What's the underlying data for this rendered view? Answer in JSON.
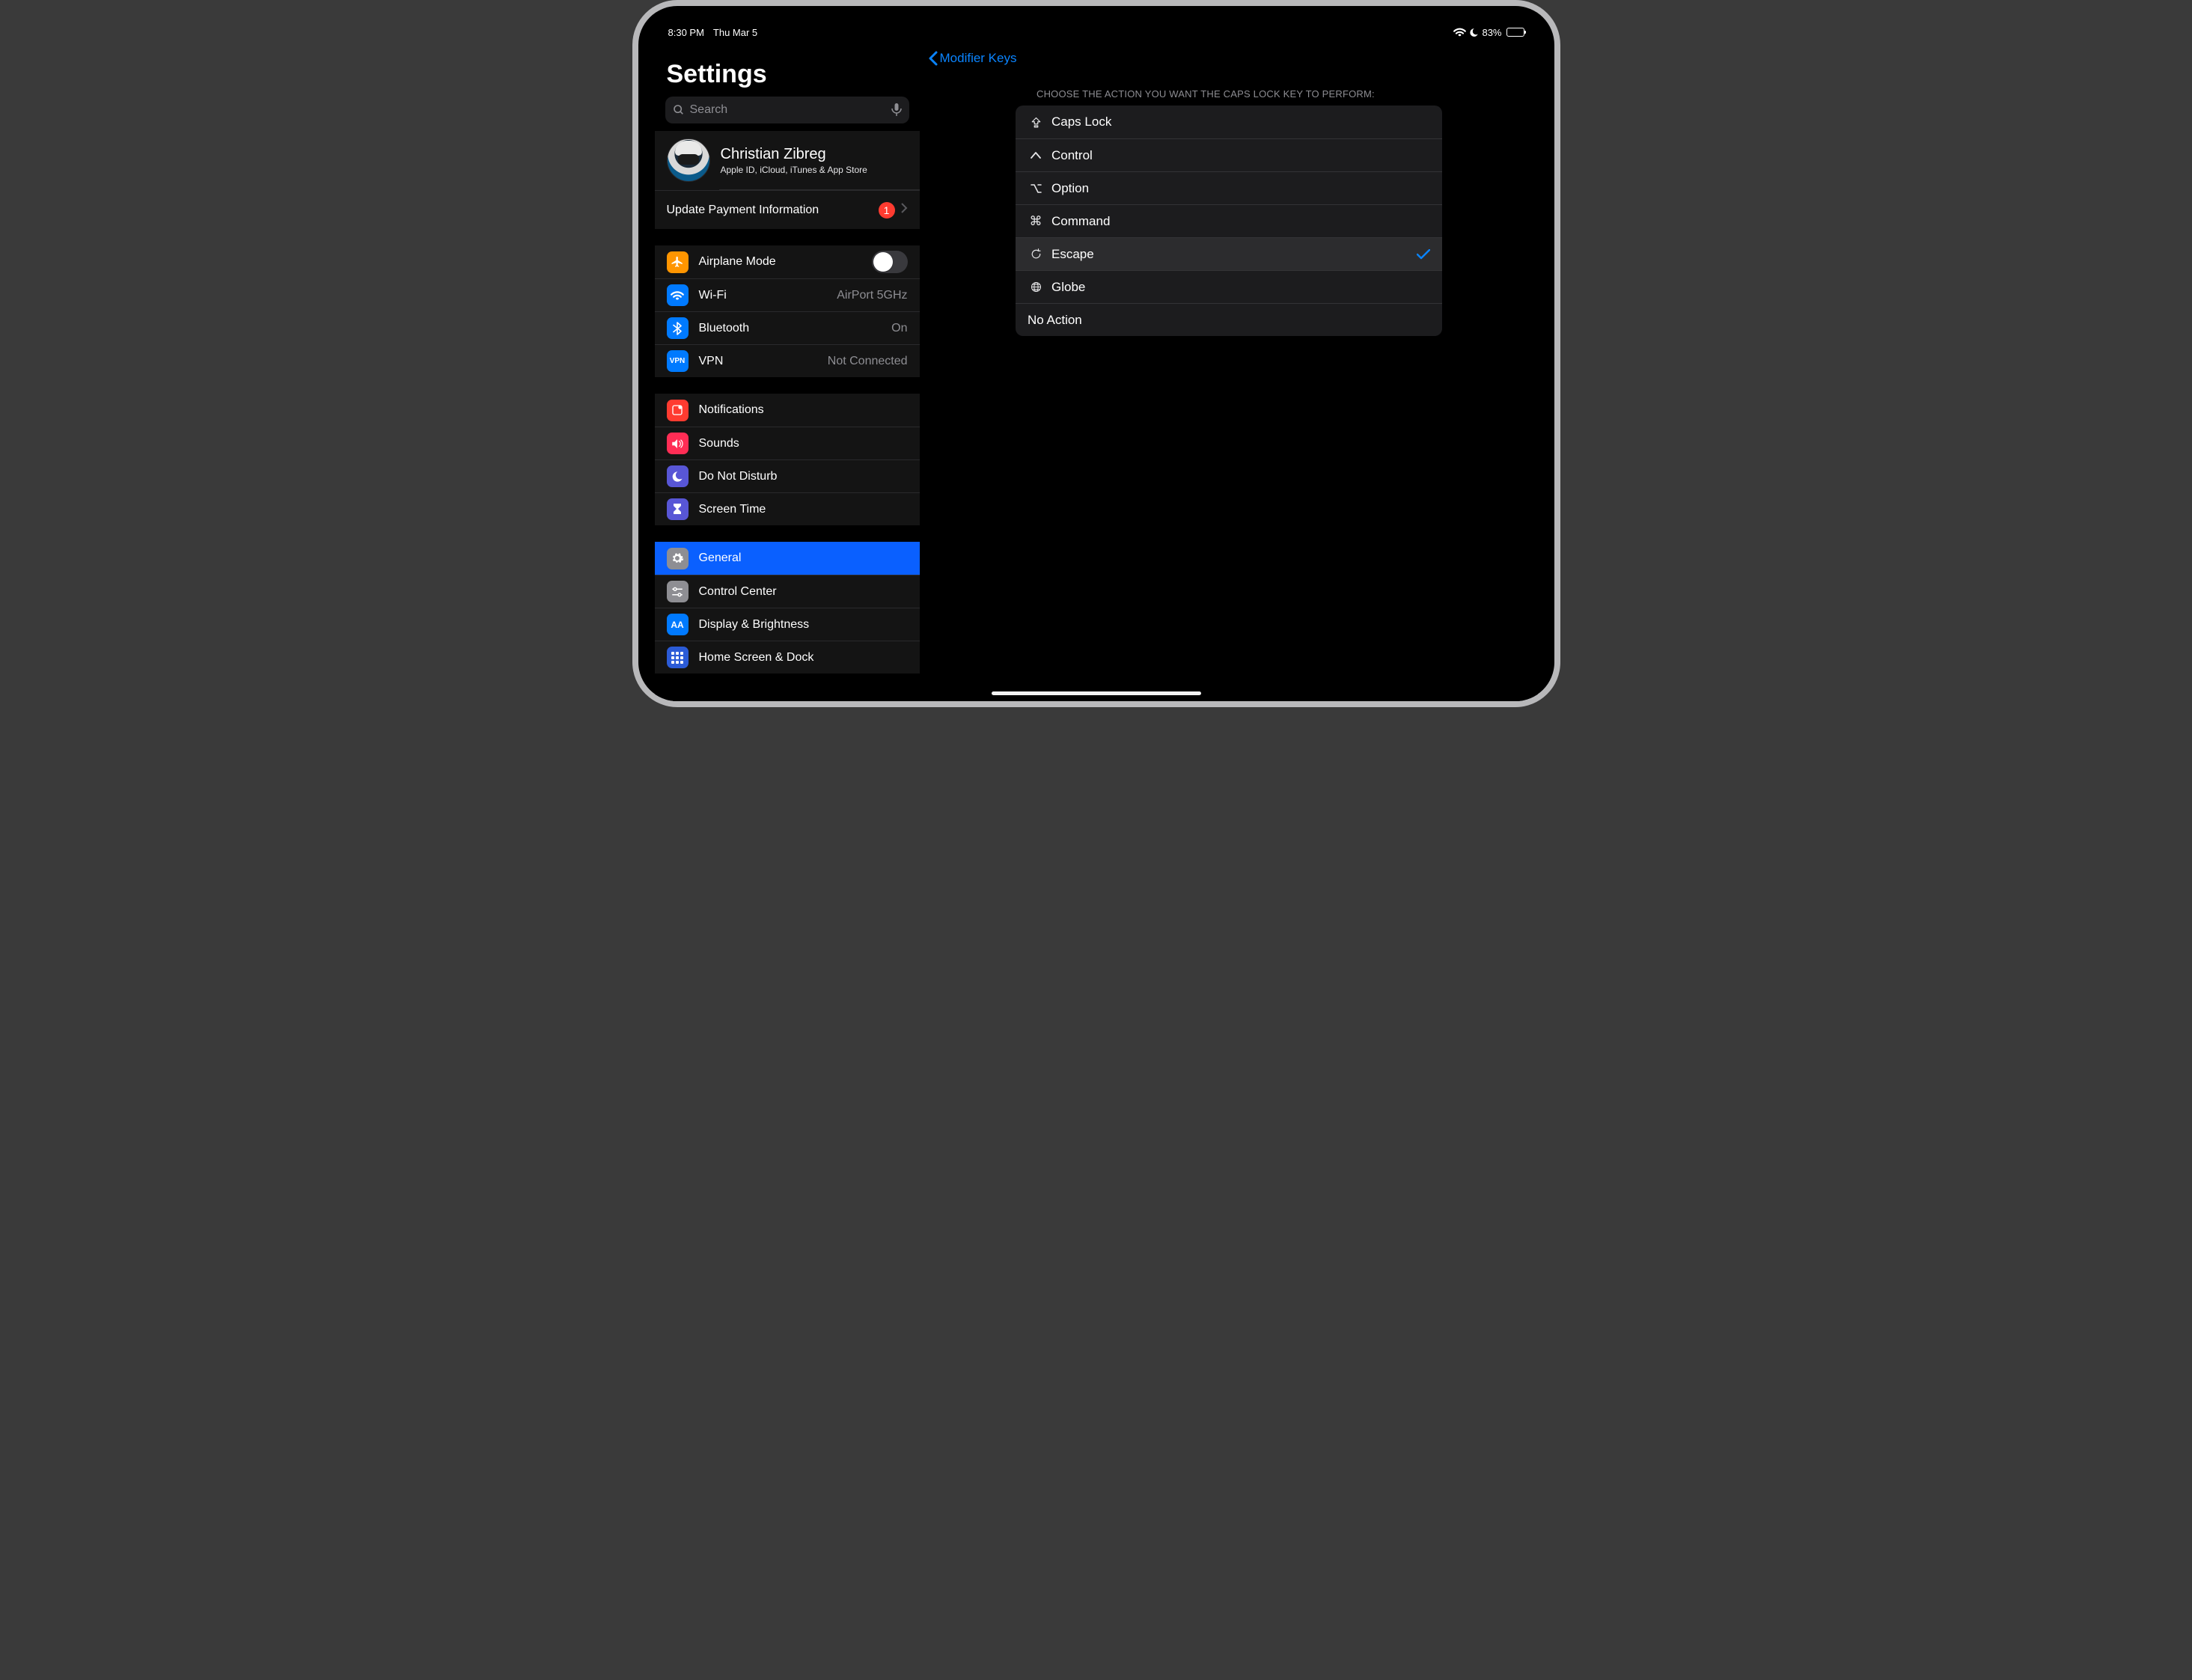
{
  "status": {
    "time": "8:30 PM",
    "date": "Thu Mar 5",
    "battery_pct": "83%",
    "battery_fill": 83
  },
  "sidebar": {
    "title": "Settings",
    "search_placeholder": "Search",
    "account": {
      "name": "Christian Zibreg",
      "subtitle": "Apple ID, iCloud, iTunes & App Store",
      "payment_label": "Update Payment Information",
      "payment_badge": "1"
    },
    "connectivity": {
      "airplane": {
        "label": "Airplane Mode"
      },
      "wifi": {
        "label": "Wi-Fi",
        "value": "AirPort 5GHz"
      },
      "bluetooth": {
        "label": "Bluetooth",
        "value": "On"
      },
      "vpn": {
        "label": "VPN",
        "value": "Not Connected"
      }
    },
    "alerts": {
      "notifications": "Notifications",
      "sounds": "Sounds",
      "dnd": "Do Not Disturb",
      "screentime": "Screen Time"
    },
    "general_group": {
      "general": "General",
      "control_center": "Control Center",
      "display": "Display & Brightness",
      "homescreen": "Home Screen & Dock"
    }
  },
  "main": {
    "back_label": "Modifier Keys",
    "section_header": "CHOOSE THE ACTION YOU WANT THE CAPS LOCK KEY TO PERFORM:",
    "options": {
      "caps": "Caps Lock",
      "control": "Control",
      "option": "Option",
      "command": "Command",
      "escape": "Escape",
      "globe": "Globe",
      "noaction": "No Action"
    },
    "selected": "escape"
  }
}
